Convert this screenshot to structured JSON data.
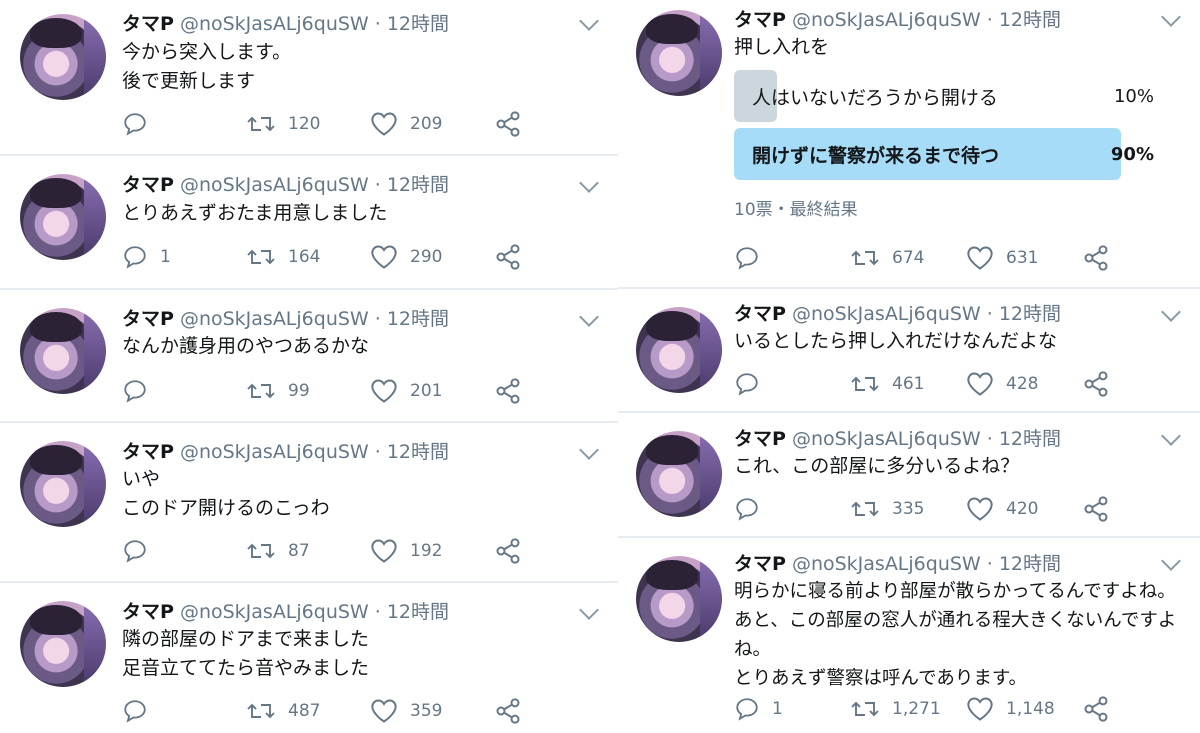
{
  "user": {
    "name": "タマP",
    "handle": "@noSkJasALj6quSW",
    "time": "12時間"
  },
  "left_tweets": [
    {
      "lines": [
        "今から突入します。",
        "後で更新します"
      ],
      "replies": "",
      "retweets": "120",
      "likes": "209"
    },
    {
      "lines": [
        "とりあえずおたま用意しました"
      ],
      "replies": "1",
      "retweets": "164",
      "likes": "290"
    },
    {
      "lines": [
        "なんか護身用のやつあるかな"
      ],
      "replies": "",
      "retweets": "99",
      "likes": "201"
    },
    {
      "lines": [
        "いや",
        "このドア開けるのこっわ"
      ],
      "replies": "",
      "retweets": "87",
      "likes": "192"
    },
    {
      "lines": [
        "隣の部屋のドアまで来ました",
        "足音立ててたら音やみました"
      ],
      "replies": "",
      "retweets": "487",
      "likes": "359"
    }
  ],
  "right_tweets": [
    {
      "lines": [
        "押し入れを"
      ],
      "poll": {
        "options": [
          {
            "label": "人はいないだろうから開ける",
            "percent": "10%",
            "fraction": 0.1,
            "winner": false
          },
          {
            "label": "開けずに警察が来るまで待つ",
            "percent": "90%",
            "fraction": 0.9,
            "winner": true
          }
        ],
        "meta": "10票・最終結果"
      },
      "replies": "",
      "retweets": "674",
      "likes": "631"
    },
    {
      "lines": [
        "いるとしたら押し入れだけなんだよな"
      ],
      "replies": "",
      "retweets": "461",
      "likes": "428"
    },
    {
      "lines": [
        "これ、この部屋に多分いるよね？"
      ],
      "replies": "",
      "retweets": "335",
      "likes": "420"
    },
    {
      "lines": [
        "明らかに寝る前より部屋が散らかってるんですよね。",
        "あと、この部屋の窓人が通れる程大きくないんですよ",
        "ね。",
        "とりあえず警察は呼んであります。"
      ],
      "replies": "1",
      "retweets": "1,271",
      "likes": "1,148"
    }
  ],
  "icons": {
    "reply": "reply-icon",
    "retweet": "retweet-icon",
    "like": "heart-icon",
    "share": "share-icon",
    "menu": "chevron-down-icon"
  },
  "colors": {
    "text": "#14171a",
    "secondary": "#657786",
    "poll_winner": "#a6dcf7",
    "poll_loser": "#ccd6dd",
    "divider": "#e6ecf0"
  }
}
